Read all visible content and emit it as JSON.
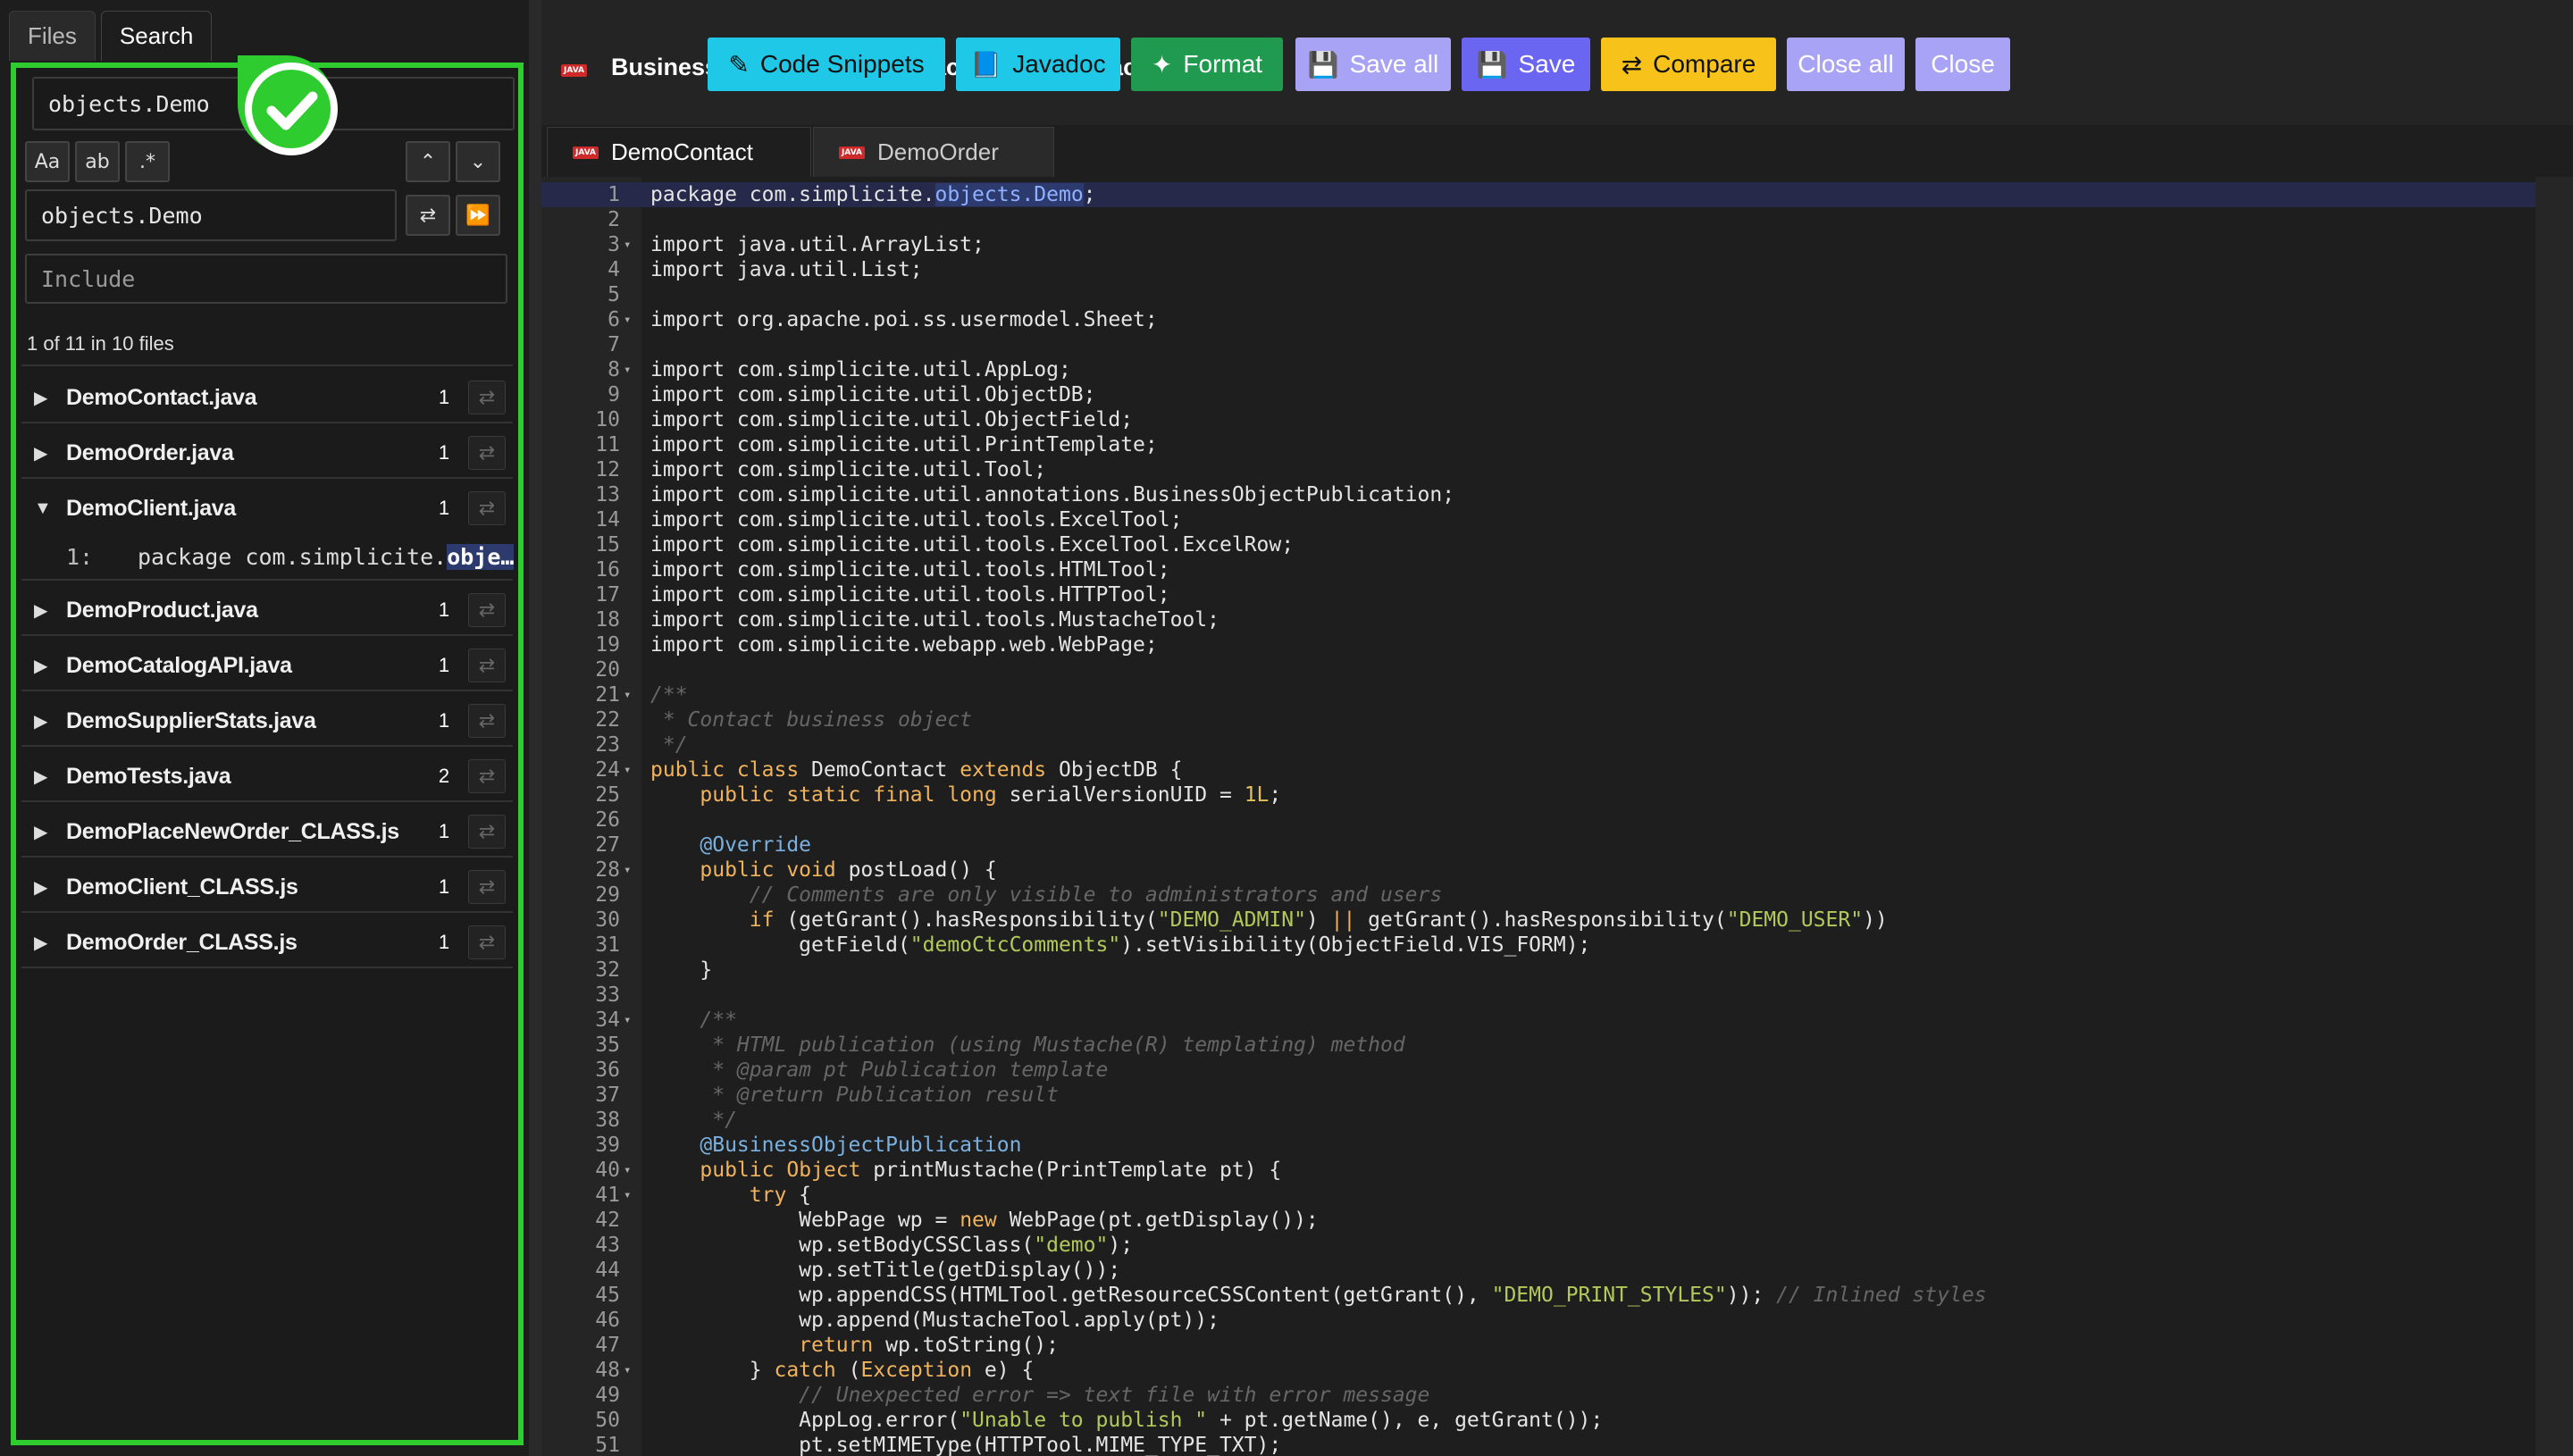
{
  "sidebar": {
    "tabs": [
      "Files",
      "Search"
    ],
    "search_query": "objects.Demo",
    "option_labels": [
      "Aa",
      "ab",
      ".*"
    ],
    "replace_value": "objects.Demo",
    "include_placeholder": "Include",
    "status": "1 of 11 in 10 files",
    "files": [
      {
        "name": "DemoContact.java",
        "count": "1",
        "expanded": false
      },
      {
        "name": "DemoOrder.java",
        "count": "1",
        "expanded": false
      },
      {
        "name": "DemoClient.java",
        "count": "1",
        "expanded": true
      },
      {
        "name": "DemoProduct.java",
        "count": "1",
        "expanded": false
      },
      {
        "name": "DemoCatalogAPI.java",
        "count": "1",
        "expanded": false
      },
      {
        "name": "DemoSupplierStats.java",
        "count": "1",
        "expanded": false
      },
      {
        "name": "DemoTests.java",
        "count": "2",
        "expanded": false
      },
      {
        "name": "DemoPlaceNewOrder_CLASS.js",
        "count": "1",
        "expanded": false
      },
      {
        "name": "DemoClient_CLASS.js",
        "count": "1",
        "expanded": false
      },
      {
        "name": "DemoOrder_CLASS.js",
        "count": "1",
        "expanded": false
      }
    ],
    "match": {
      "line": "1:",
      "prefix": "package com.simplicite.",
      "highlight": "obje…"
    }
  },
  "header": {
    "badge_label": "JAVA",
    "title": "Business object: DemoContact / DemoContact.java",
    "buttons": [
      {
        "label": "Code Snippets",
        "icon": "edit-icon",
        "color": "#1ec8e6"
      },
      {
        "label": "Javadoc",
        "icon": "book-icon",
        "color": "#1ec8e6"
      },
      {
        "label": "Format",
        "icon": "magic-wand-icon",
        "color": "#1f9a4e"
      },
      {
        "label": "Save all",
        "icon": "save-icon",
        "color": "#a9a3f5"
      },
      {
        "label": "Save",
        "icon": "save-icon",
        "color": "#6b66f2"
      },
      {
        "label": "Compare",
        "icon": "swap-icon",
        "color": "#f7c31a"
      },
      {
        "label": "Close all",
        "icon": "",
        "color": "#a9a3f5"
      },
      {
        "label": "Close",
        "icon": "",
        "color": "#a9a3f5"
      }
    ]
  },
  "editor": {
    "tabs": [
      "DemoContact",
      "DemoOrder"
    ],
    "lines": [
      {
        "n": "1",
        "f": "",
        "c": "package com.simplicite.<m>objects.Demo</m>;"
      },
      {
        "n": "2",
        "f": "",
        "c": ""
      },
      {
        "n": "3",
        "f": "▾",
        "c": "import java.util.ArrayList;"
      },
      {
        "n": "4",
        "f": "",
        "c": "import java.util.List;"
      },
      {
        "n": "5",
        "f": "",
        "c": ""
      },
      {
        "n": "6",
        "f": "▾",
        "c": "import org.apache.poi.ss.usermodel.Sheet;"
      },
      {
        "n": "7",
        "f": "",
        "c": ""
      },
      {
        "n": "8",
        "f": "▾",
        "c": "import com.simplicite.util.AppLog;"
      },
      {
        "n": "9",
        "f": "",
        "c": "import com.simplicite.util.ObjectDB;"
      },
      {
        "n": "10",
        "f": "",
        "c": "import com.simplicite.util.ObjectField;"
      },
      {
        "n": "11",
        "f": "",
        "c": "import com.simplicite.util.PrintTemplate;"
      },
      {
        "n": "12",
        "f": "",
        "c": "import com.simplicite.util.Tool;"
      },
      {
        "n": "13",
        "f": "",
        "c": "import com.simplicite.util.annotations.BusinessObjectPublication;"
      },
      {
        "n": "14",
        "f": "",
        "c": "import com.simplicite.util.tools.ExcelTool;"
      },
      {
        "n": "15",
        "f": "",
        "c": "import com.simplicite.util.tools.ExcelTool.ExcelRow;"
      },
      {
        "n": "16",
        "f": "",
        "c": "import com.simplicite.util.tools.HTMLTool;"
      },
      {
        "n": "17",
        "f": "",
        "c": "import com.simplicite.util.tools.HTTPTool;"
      },
      {
        "n": "18",
        "f": "",
        "c": "import com.simplicite.util.tools.MustacheTool;"
      },
      {
        "n": "19",
        "f": "",
        "c": "import com.simplicite.webapp.web.WebPage;"
      },
      {
        "n": "20",
        "f": "",
        "c": ""
      },
      {
        "n": "21",
        "f": "▾",
        "c": "<c>/**</c>"
      },
      {
        "n": "22",
        "f": "",
        "c": "<c> * Contact business object</c>"
      },
      {
        "n": "23",
        "f": "",
        "c": "<c> */</c>"
      },
      {
        "n": "24",
        "f": "▾",
        "c": "<k>public class</k> DemoContact <k>extends</k> ObjectDB {"
      },
      {
        "n": "25",
        "f": "",
        "c": "    <k>public static final long</k> serialVersionUID = <u>1L</u>;"
      },
      {
        "n": "26",
        "f": "",
        "c": ""
      },
      {
        "n": "27",
        "f": "",
        "c": "    <a>@Override</a>"
      },
      {
        "n": "28",
        "f": "▾",
        "c": "    <k>public void</k> postLoad() {"
      },
      {
        "n": "29",
        "f": "",
        "c": "        <c>// Comments are only visible to administrators and users</c>"
      },
      {
        "n": "30",
        "f": "",
        "c": "        <k>if</k> (getGrant().hasResponsibility(<s>\"DEMO_ADMIN\"</s>) <k>||</k> getGrant().hasResponsibility(<s>\"DEMO_USER\"</s>))"
      },
      {
        "n": "31",
        "f": "",
        "c": "            getField(<s>\"demoCtcComments\"</s>).setVisibility(ObjectField.VIS_FORM);"
      },
      {
        "n": "32",
        "f": "",
        "c": "    }"
      },
      {
        "n": "33",
        "f": "",
        "c": ""
      },
      {
        "n": "34",
        "f": "▾",
        "c": "    <c>/**</c>"
      },
      {
        "n": "35",
        "f": "",
        "c": "<c>     * HTML publication (using Mustache(R) templating) method</c>"
      },
      {
        "n": "36",
        "f": "",
        "c": "<c>     * @param pt Publication template</c>"
      },
      {
        "n": "37",
        "f": "",
        "c": "<c>     * @return Publication result</c>"
      },
      {
        "n": "38",
        "f": "",
        "c": "<c>     */</c>"
      },
      {
        "n": "39",
        "f": "",
        "c": "    <a>@BusinessObjectPublication</a>"
      },
      {
        "n": "40",
        "f": "▾",
        "c": "    <k>public</k> <k>Object</k> printMustache(PrintTemplate pt) {"
      },
      {
        "n": "41",
        "f": "▾",
        "c": "        <k>try</k> {"
      },
      {
        "n": "42",
        "f": "",
        "c": "            WebPage wp = <k>new</k> WebPage(pt.getDisplay());"
      },
      {
        "n": "43",
        "f": "",
        "c": "            wp.setBodyCSSClass(<s>\"demo\"</s>);"
      },
      {
        "n": "44",
        "f": "",
        "c": "            wp.setTitle(getDisplay());"
      },
      {
        "n": "45",
        "f": "",
        "c": "            wp.appendCSS(HTMLTool.getResourceCSSContent(getGrant(), <s>\"DEMO_PRINT_STYLES\"</s>)); <c>// Inlined styles</c>"
      },
      {
        "n": "46",
        "f": "",
        "c": "            wp.append(MustacheTool.apply(pt));"
      },
      {
        "n": "47",
        "f": "",
        "c": "            <k>return</k> wp.toString();"
      },
      {
        "n": "48",
        "f": "▾",
        "c": "        } <k>catch</k> (<k>Exception</k> e) {"
      },
      {
        "n": "49",
        "f": "",
        "c": "            <c>// Unexpected error => text file with error message</c>"
      },
      {
        "n": "50",
        "f": "",
        "c": "            AppLog.error(<s>\"Unable to publish \"</s> + pt.getName(), e, getGrant());"
      },
      {
        "n": "51",
        "f": "",
        "c": "            pt.setMIMEType(HTTPTool.MIME_TYPE_TXT);"
      }
    ]
  }
}
